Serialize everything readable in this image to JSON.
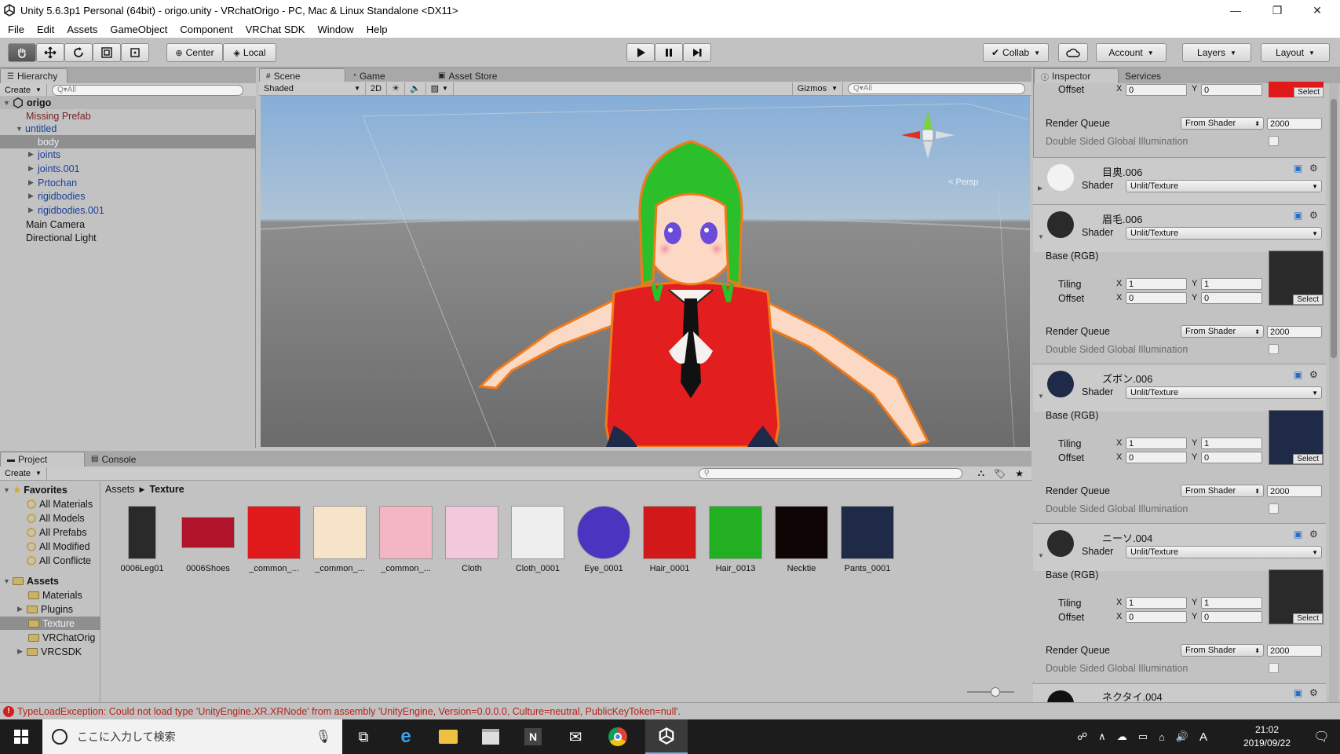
{
  "window": {
    "title": "Unity 5.6.3p1 Personal (64bit) - origo.unity - VRchatOrigo - PC, Mac & Linux Standalone <DX11>",
    "controls": {
      "minimize": "—",
      "restore": "❐",
      "close": "✕"
    }
  },
  "menu": [
    "File",
    "Edit",
    "Assets",
    "GameObject",
    "Component",
    "VRChat SDK",
    "Window",
    "Help"
  ],
  "toolbar": {
    "pivot": "Center",
    "space": "Local",
    "collab": "Collab",
    "account": "Account",
    "layers": "Layers",
    "layout": "Layout"
  },
  "hierarchy": {
    "tab": "Hierarchy",
    "create": "Create",
    "search_placeholder": "Q▾All",
    "scene": "origo",
    "rows": [
      {
        "label": "Missing Prefab"
      },
      {
        "label": "untitled"
      },
      {
        "label": "body"
      },
      {
        "label": "joints"
      },
      {
        "label": "joints.001"
      },
      {
        "label": "Prtochan"
      },
      {
        "label": "rigidbodies"
      },
      {
        "label": "rigidbodies.001"
      },
      {
        "label": "Main Camera"
      },
      {
        "label": "Directional Light"
      }
    ]
  },
  "scene": {
    "tabs": [
      "Scene",
      "Game",
      "Asset Store"
    ],
    "shading": "Shaded",
    "mode_2d": "2D",
    "gizmos": "Gizmos",
    "search_placeholder": "Q▾All",
    "persp": "< Persp"
  },
  "project": {
    "tabs": [
      "Project",
      "Console"
    ],
    "create": "Create",
    "favorites_label": "Favorites",
    "favorites": [
      "All Materials",
      "All Models",
      "All Prefabs",
      "All Modified",
      "All Conflicte"
    ],
    "assets_label": "Assets",
    "folders": [
      "Materials",
      "Plugins",
      "Texture",
      "VRChatOrig",
      "VRCSDK"
    ],
    "breadcrumb": [
      "Assets",
      "Texture"
    ],
    "assets": [
      {
        "name": "0006Leg01",
        "color": "#2a2a2a"
      },
      {
        "name": "0006Shoes",
        "color": "#b0142a"
      },
      {
        "name": "_common_...",
        "color": "#e01a1a"
      },
      {
        "name": "_common_...",
        "color": "#f7e3c8"
      },
      {
        "name": "_common_...",
        "color": "#f4b6c4"
      },
      {
        "name": "Cloth",
        "color": "#f2c8dc"
      },
      {
        "name": "Cloth_0001",
        "color": "#eeeeee"
      },
      {
        "name": "Eye_0001",
        "color": "#4a34c0"
      },
      {
        "name": "Hair_0001",
        "color": "#d21818"
      },
      {
        "name": "Hair_0013",
        "color": "#22b022"
      },
      {
        "name": "Necktie",
        "color": "#100505"
      },
      {
        "name": "Pants_0001",
        "color": "#1e2a48"
      }
    ]
  },
  "inspector": {
    "tabs": [
      "Inspector",
      "Services"
    ],
    "top": {
      "offset_label": "Offset",
      "offset_x": "0",
      "offset_y": "0",
      "render_queue": "Render Queue",
      "from_shader": "From Shader",
      "queue_value": "2000",
      "dsgi": "Double Sided Global Illumination"
    },
    "shader_label": "Shader",
    "shader_value": "Unlit/Texture",
    "base_label": "Base (RGB)",
    "tiling_label": "Tiling",
    "offset_label": "Offset",
    "select_label": "Select",
    "axis_x": "X",
    "axis_y": "Y",
    "materials": [
      {
        "name": "目奥.006",
        "ball": "#f0f0f0",
        "expanded": false
      },
      {
        "name": "眉毛.006",
        "ball": "#2a2a2a",
        "expanded": true,
        "tiling_x": "1",
        "tiling_y": "1",
        "offset_x": "0",
        "offset_y": "0",
        "tex": "#2a2a2a"
      },
      {
        "name": "ズボン.006",
        "ball": "#1e2a48",
        "expanded": true,
        "tiling_x": "1",
        "tiling_y": "1",
        "offset_x": "0",
        "offset_y": "0",
        "tex": "#1e2a48"
      },
      {
        "name": "ニーソ.004",
        "ball": "#2a2a2a",
        "expanded": true,
        "tiling_x": "1",
        "tiling_y": "1",
        "offset_x": "0",
        "offset_y": "0",
        "tex": "#2a2a2a"
      },
      {
        "name": "ネクタイ.004",
        "ball": "#111111",
        "expanded": false
      }
    ]
  },
  "status": {
    "error": "TypeLoadException: Could not load type 'UnityEngine.XR.XRNode' from assembly 'UnityEngine, Version=0.0.0.0, Culture=neutral, PublicKeyToken=null'."
  },
  "taskbar": {
    "search_placeholder": "ここに入力して検索",
    "ime": "A",
    "time": "21:02",
    "date": "2019/09/22"
  }
}
